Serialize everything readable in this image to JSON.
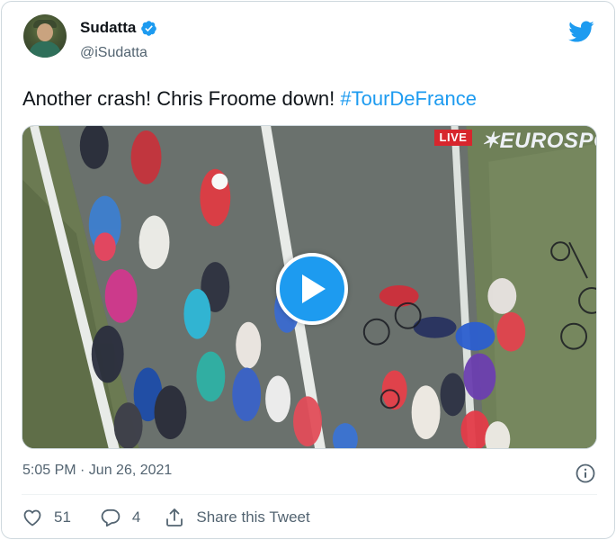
{
  "tweet": {
    "author": {
      "display_name": "Sudatta",
      "handle": "@iSudatta",
      "verified_icon": "verified-badge-icon"
    },
    "text_prefix": "Another crash! Chris Froome down! ",
    "hashtag": "#TourDeFrance",
    "media": {
      "type": "video",
      "live_badge": "LIVE",
      "broadcaster": "EUROSPO",
      "play_icon": "play-icon"
    },
    "timestamp": "5:05 PM · Jun 26, 2021",
    "stats": {
      "likes": "51",
      "replies": "4",
      "share_label": "Share this Tweet"
    }
  },
  "colors": {
    "accent": "#1d9bf0",
    "text_primary": "#0f1419",
    "text_secondary": "#536471",
    "live_red": "#d7262d"
  }
}
